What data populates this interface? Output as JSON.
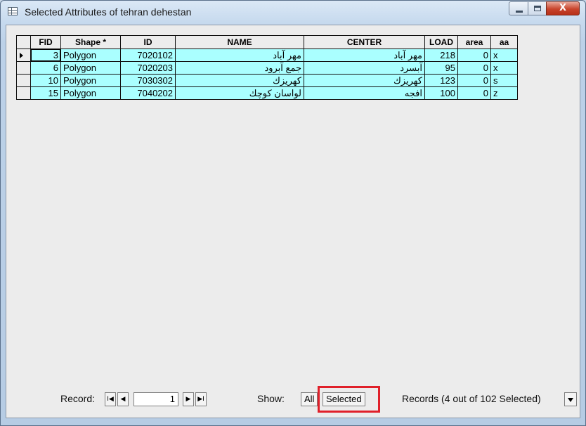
{
  "window": {
    "title": "Selected Attributes of tehran dehestan",
    "close_glyph": "X"
  },
  "table": {
    "columns": [
      "FID",
      "Shape *",
      "ID",
      "NAME",
      "CENTER",
      "LOAD",
      "area",
      "aa"
    ],
    "rows": [
      {
        "FID": "3",
        "Shape": "Polygon",
        "ID": "7020102",
        "NAME": "مهر آباد",
        "CENTER": "مهر آباد",
        "LOAD": "218",
        "area": "0",
        "aa": "x"
      },
      {
        "FID": "6",
        "Shape": "Polygon",
        "ID": "7020203",
        "NAME": "جمع آبرود",
        "CENTER": "آبسرد",
        "LOAD": "95",
        "area": "0",
        "aa": "x"
      },
      {
        "FID": "10",
        "Shape": "Polygon",
        "ID": "7030302",
        "NAME": "كهريزك",
        "CENTER": "كهريزك",
        "LOAD": "123",
        "area": "0",
        "aa": "s"
      },
      {
        "FID": "15",
        "Shape": "Polygon",
        "ID": "7040202",
        "NAME": "لواسان كوچك",
        "CENTER": "افجه",
        "LOAD": "100",
        "area": "0",
        "aa": "z"
      }
    ],
    "row_fill_color": "#aaffff"
  },
  "footer": {
    "record_label": "Record:",
    "record_value": "1",
    "first_glyph": "I◀",
    "prev_glyph": "◀",
    "next_glyph": "▶",
    "last_glyph": "▶I",
    "show_label": "Show:",
    "all_label": "All",
    "selected_label": "Selected",
    "records_status": "Records (4 out of 102 Selected)",
    "highlight_color": "#e0202a"
  }
}
